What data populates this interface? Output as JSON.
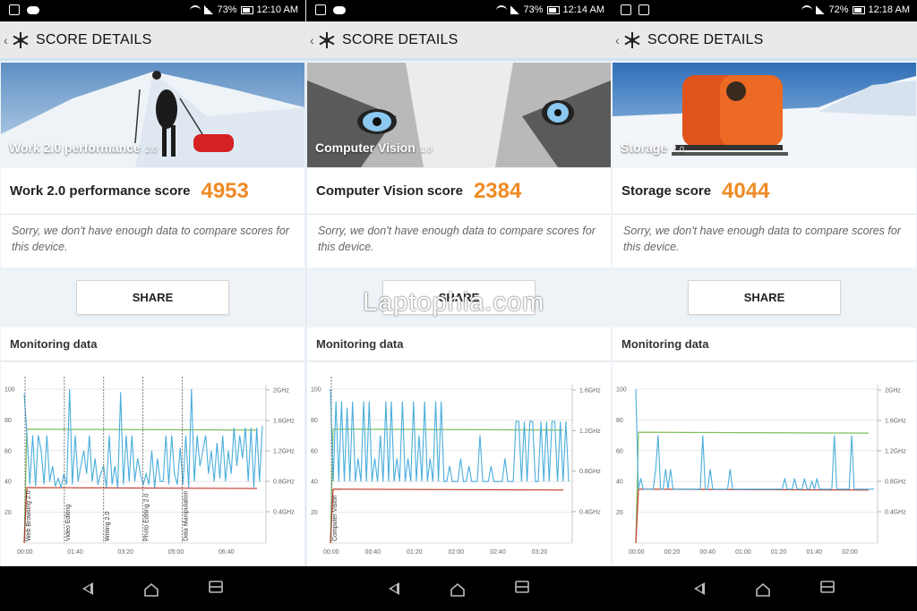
{
  "panels": [
    {
      "status": {
        "battery": "73%",
        "time": "12:10 AM"
      },
      "title": "SCORE DETAILS",
      "hero_label": "Work 2.0 performance",
      "hero_version": "2.0",
      "score_label": "Work 2.0 performance score",
      "score_value": "4953",
      "compare_text": "Sorry, we don't have enough data to compare scores for this device.",
      "share_label": "SHARE",
      "monitoring_label": "Monitoring data",
      "chart_data": {
        "type": "line",
        "y_left_ticks": [
          "100",
          "80",
          "60",
          "40",
          "20"
        ],
        "y_right_ticks": [
          "2GHz",
          "1.6GHz",
          "1.2GHz",
          "0.8GHz",
          "0.4GHz"
        ],
        "x_ticks": [
          "00:00",
          "01:40",
          "03:20",
          "05:00",
          "06:40"
        ],
        "markers": [
          "Web Browsing 2.0",
          "Video Editing",
          "Writing 2.0",
          "Photo Editing 2.0",
          "Data Manipulation"
        ],
        "ylim": [
          0,
          100
        ],
        "green_level": 74,
        "red_level": 36,
        "blue_series": [
          97,
          70,
          38,
          70,
          37,
          70,
          60,
          38,
          70,
          40,
          50,
          37,
          42,
          36,
          45,
          38,
          100,
          38,
          70,
          40,
          50,
          60,
          45,
          70,
          40,
          55,
          38,
          45,
          50,
          36,
          70,
          38,
          50,
          36,
          98,
          38,
          70,
          40,
          70,
          40,
          55,
          45,
          38,
          45,
          38,
          60,
          36,
          55,
          40,
          40,
          70,
          38,
          70,
          45,
          38,
          62,
          38,
          70,
          36,
          100,
          40,
          70,
          50,
          60,
          70,
          45,
          60,
          40,
          65,
          42,
          70,
          40,
          60,
          45,
          75,
          50,
          70,
          55,
          75,
          40,
          75,
          36,
          75,
          40,
          76
        ]
      }
    },
    {
      "status": {
        "battery": "73%",
        "time": "12:14 AM"
      },
      "title": "SCORE DETAILS",
      "hero_label": "Computer Vision",
      "hero_version": "1.0",
      "score_label": "Computer Vision score",
      "score_value": "2384",
      "compare_text": "Sorry, we don't have enough data to compare scores for this device.",
      "share_label": "SHARE",
      "monitoring_label": "Monitoring data",
      "chart_data": {
        "type": "line",
        "y_left_ticks": [
          "100",
          "80",
          "60",
          "40",
          "20"
        ],
        "y_right_ticks": [
          "1.6GHz",
          "1.2GHz",
          "0.8GHz",
          "0.4GHz"
        ],
        "x_ticks": [
          "00:00",
          "00:40",
          "01:20",
          "02:00",
          "02:40",
          "03:20"
        ],
        "markers": [
          "Computer Vision"
        ],
        "ylim": [
          0,
          100
        ],
        "green_level": 74,
        "red_level": 35,
        "blue_series": [
          100,
          40,
          92,
          40,
          92,
          40,
          88,
          40,
          92,
          40,
          55,
          40,
          92,
          40,
          92,
          40,
          55,
          40,
          70,
          40,
          92,
          40,
          92,
          40,
          55,
          40,
          92,
          40,
          55,
          40,
          92,
          40,
          70,
          40,
          92,
          40,
          55,
          40,
          92,
          40,
          92,
          40,
          40,
          50,
          40,
          40,
          40,
          55,
          40,
          40,
          50,
          40,
          40,
          40,
          70,
          40,
          40,
          40,
          50,
          40,
          40,
          40,
          40,
          55,
          40,
          40,
          40,
          79,
          79,
          40,
          79,
          40,
          79,
          79,
          40,
          40,
          79,
          40,
          79,
          40,
          79,
          79,
          40,
          79,
          40,
          79,
          40
        ]
      }
    },
    {
      "status": {
        "battery": "72%",
        "time": "12:18 AM"
      },
      "title": "SCORE DETAILS",
      "hero_label": "Storage",
      "hero_version": "1.0",
      "score_label": "Storage score",
      "score_value": "4044",
      "compare_text": "Sorry, we don't have enough data to compare scores for this device.",
      "share_label": "SHARE",
      "monitoring_label": "Monitoring data",
      "chart_data": {
        "type": "line",
        "y_left_ticks": [
          "100",
          "80",
          "60",
          "40",
          "20"
        ],
        "y_right_ticks": [
          "2GHz",
          "1.6GHz",
          "1.2GHz",
          "0.8GHz",
          "0.4GHz"
        ],
        "x_ticks": [
          "00:00",
          "00:20",
          "00:40",
          "01:00",
          "01:20",
          "01:40",
          "02:00"
        ],
        "markers": [],
        "ylim": [
          0,
          100
        ],
        "green_level": 72,
        "red_level": 35,
        "blue_series": [
          100,
          35,
          42,
          35,
          35,
          35,
          35,
          35,
          48,
          70,
          35,
          35,
          48,
          35,
          48,
          35,
          35,
          35,
          35,
          35,
          35,
          35,
          35,
          35,
          35,
          35,
          35,
          70,
          35,
          35,
          48,
          35,
          35,
          35,
          35,
          35,
          35,
          35,
          48,
          35,
          35,
          35,
          35,
          35,
          35,
          35,
          35,
          35,
          35,
          35,
          35,
          35,
          35,
          35,
          35,
          35,
          35,
          35,
          35,
          35,
          42,
          35,
          35,
          35,
          42,
          35,
          35,
          35,
          42,
          35,
          35,
          40,
          35,
          42,
          35,
          35,
          35,
          35,
          35,
          35,
          70,
          35,
          35,
          35,
          35,
          35,
          35,
          70,
          35,
          35,
          35,
          35,
          35,
          35,
          35,
          35,
          35
        ]
      }
    }
  ],
  "watermark": "Laptophia.com",
  "colors": {
    "accent": "#f08a24",
    "blue_line": "#4aaedc",
    "green_line": "#7fbf5f",
    "red_line": "#c0392b"
  }
}
